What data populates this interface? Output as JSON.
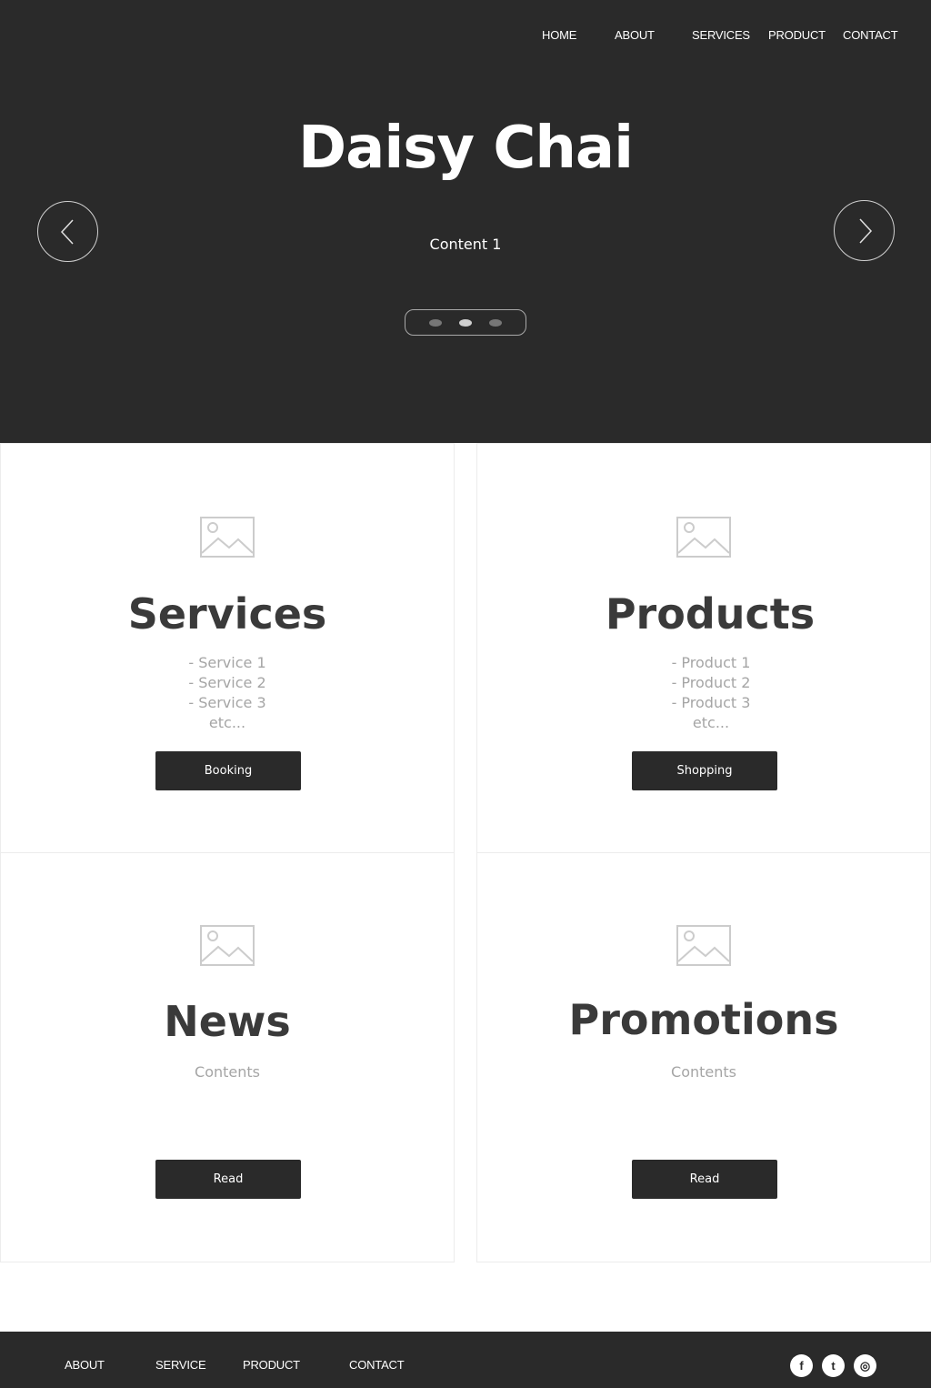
{
  "nav": {
    "items": [
      "HOME",
      "ABOUT",
      "SERVICES",
      "PRODUCT",
      "CONTACT"
    ]
  },
  "hero": {
    "title": "Daisy Chai",
    "subtitle": "Content 1",
    "slide_count": 3,
    "active_slide": 2
  },
  "icons": {
    "prev": "chevron-left-icon",
    "next": "chevron-right-icon",
    "placeholder": "image-placeholder-icon",
    "facebook": "facebook-icon",
    "twitter": "twitter-icon",
    "dribbble": "dribbble-icon"
  },
  "cards": {
    "services": {
      "title": "Services",
      "lines": [
        "- Service 1",
        "- Service 2",
        "- Service 3",
        "etc..."
      ],
      "button": "Booking"
    },
    "products": {
      "title": "Products",
      "lines": [
        "- Product 1",
        "- Product 2",
        "- Product 3",
        "etc..."
      ],
      "button": "Shopping"
    },
    "news": {
      "title": "News",
      "body": "Contents",
      "button": "Read"
    },
    "promotions": {
      "title": "Promotions",
      "body": "Contents",
      "button": "Read"
    }
  },
  "footer": {
    "links": [
      "ABOUT",
      "SERVICE",
      "PRODUCT",
      "CONTACT"
    ],
    "social": {
      "facebook_glyph": "f",
      "twitter_glyph": "t",
      "dribbble_glyph": "◎"
    }
  },
  "colors": {
    "dark": "#2a2a2a",
    "title_text": "#3a3a3a",
    "muted_text": "#a5a5a5",
    "placeholder_icon": "#cccccc",
    "white": "#ffffff"
  }
}
